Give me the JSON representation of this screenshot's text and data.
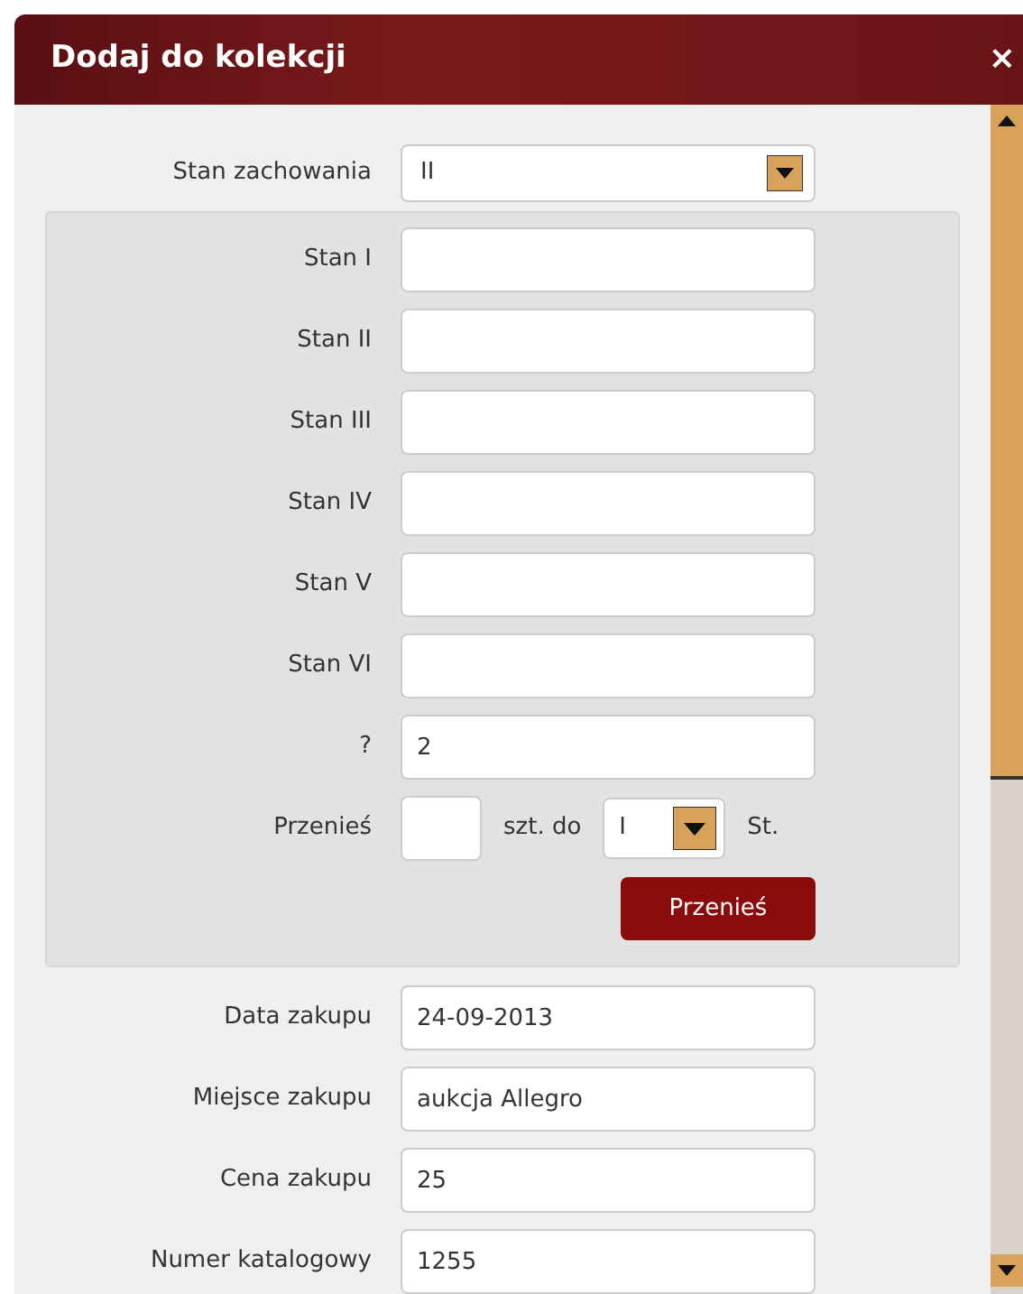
{
  "dialog": {
    "title": "Dodaj do kolekcji",
    "close": "×"
  },
  "condition": {
    "label": "Stan zachowania",
    "value": "II"
  },
  "panel": {
    "fields": [
      {
        "label": "Stan I"
      },
      {
        "label": "Stan II"
      },
      {
        "label": "Stan III"
      },
      {
        "label": "Stan IV"
      },
      {
        "label": "Stan V"
      },
      {
        "label": "Stan VI"
      },
      {
        "label": "?",
        "value": "2"
      }
    ],
    "transfer": {
      "label": "Przenieś",
      "middle": "szt. do",
      "target": "I",
      "suffix": "St.",
      "button": "Przenieś"
    }
  },
  "purchase": [
    {
      "label": "Data zakupu",
      "value": "24-09-2013"
    },
    {
      "label": "Miejsce zakupu",
      "value": "aukcja Allegro"
    },
    {
      "label": "Cena zakupu",
      "value": "25"
    },
    {
      "label": "Numer katalogowy",
      "value": "1255"
    }
  ]
}
